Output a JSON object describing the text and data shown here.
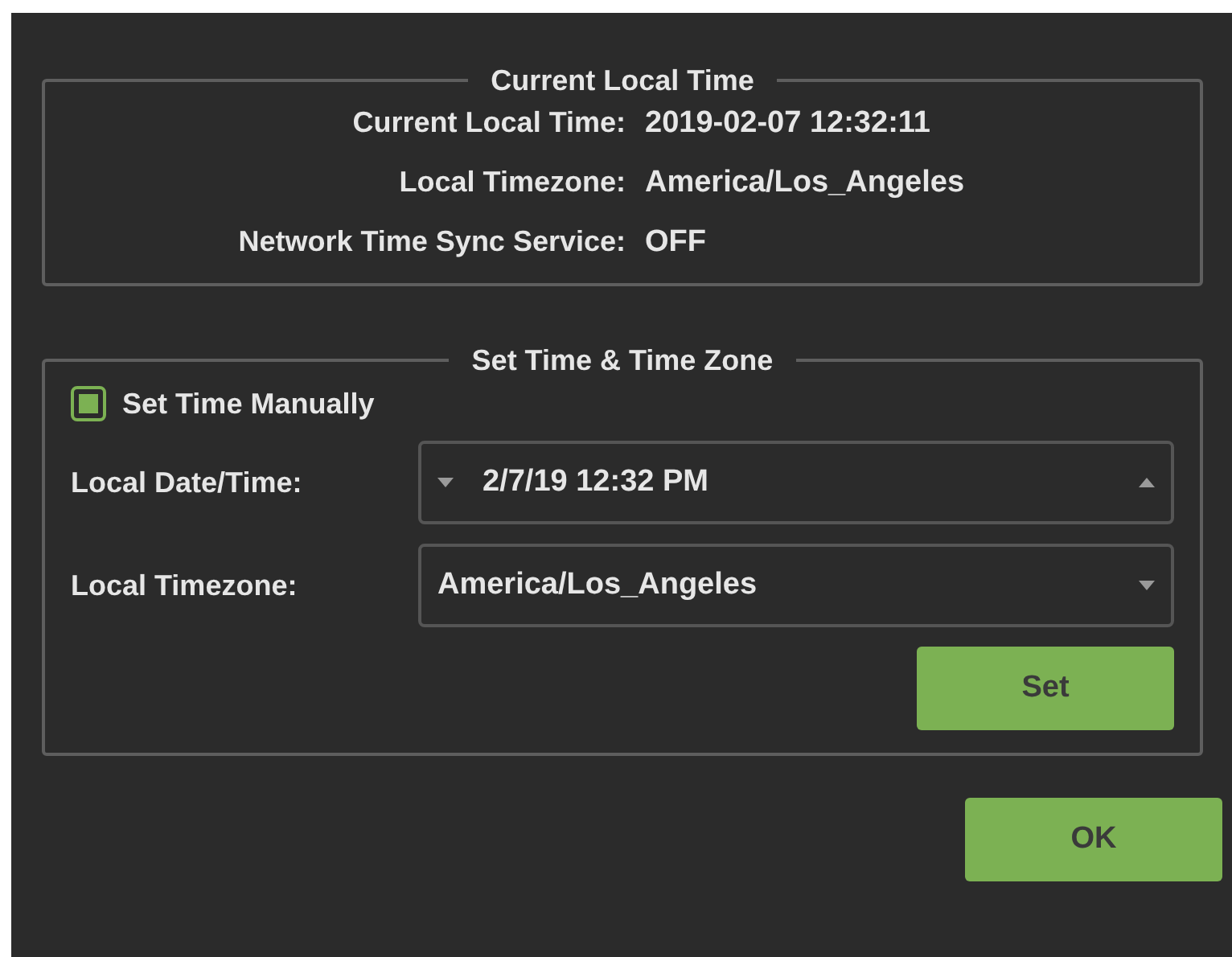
{
  "current_group": {
    "title": "Current Local Time",
    "rows": [
      {
        "label": "Current Local Time:",
        "value": "2019-02-07 12:32:11"
      },
      {
        "label": "Local Timezone:",
        "value": "America/Los_Angeles"
      },
      {
        "label": "Network Time Sync Service:",
        "value": "OFF"
      }
    ]
  },
  "set_group": {
    "title": "Set Time & Time Zone",
    "manual": {
      "label": "Set Time Manually",
      "checked": true
    },
    "datetime": {
      "label": "Local Date/Time:",
      "value": "2/7/19 12:32 PM"
    },
    "timezone": {
      "label": "Local Timezone:",
      "value": "America/Los_Angeles"
    },
    "set_button": "Set"
  },
  "ok_button": "OK"
}
